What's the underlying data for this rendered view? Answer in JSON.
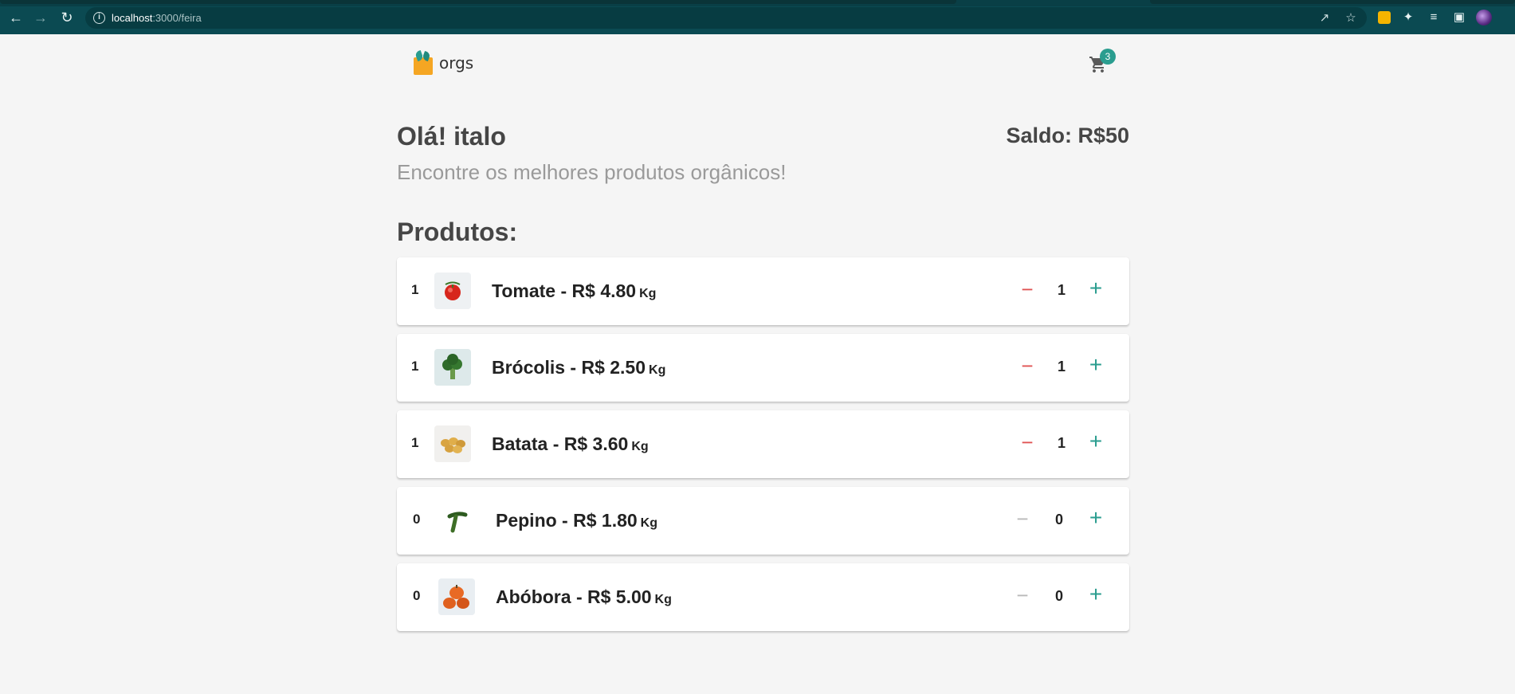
{
  "browser": {
    "url_host": "localhost",
    "url_path": ":3000/feira"
  },
  "header": {
    "logo_text": "orgs",
    "cart_count": "3"
  },
  "greeting": "Olá! italo",
  "saldo": "Saldo: R$50",
  "subtitle": "Encontre os melhores produtos orgânicos!",
  "products_title": "Produtos:",
  "products": [
    {
      "qty": "1",
      "name": "Tomate - R$ 4.80",
      "unit": "Kg",
      "thumb": "tomato-image"
    },
    {
      "qty": "1",
      "name": "Brócolis - R$ 2.50",
      "unit": "Kg",
      "thumb": "broccoli-image"
    },
    {
      "qty": "1",
      "name": "Batata - R$ 3.60",
      "unit": "Kg",
      "thumb": "potato-image"
    },
    {
      "qty": "0",
      "name": "Pepino - R$ 1.80",
      "unit": "Kg",
      "thumb": "cucumber-image"
    },
    {
      "qty": "0",
      "name": "Abóbora - R$ 5.00",
      "unit": "Kg",
      "thumb": "pumpkin-image"
    }
  ],
  "colors": {
    "browser_bar": "#0b4a52",
    "accent": "#2a9d8f",
    "minus_active": "#e05252",
    "minus_disabled": "#b9b9b9",
    "logo_bag": "#f5a623"
  }
}
